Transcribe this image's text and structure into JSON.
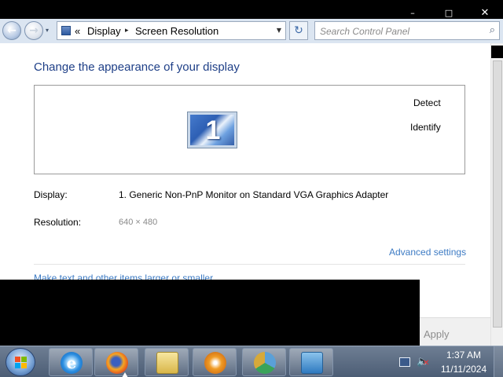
{
  "window": {
    "controls": {
      "minimize": "–",
      "maximize": "□",
      "close": "✕"
    }
  },
  "navbar": {
    "back_icon": "back-arrow-icon",
    "forward_icon": "forward-arrow-icon",
    "recent_pages": "▾",
    "breadcrumb_chevron": "«",
    "breadcrumb": [
      "Display",
      "Screen Resolution"
    ],
    "breadcrumb_sep": "▸",
    "dropdown": "▼",
    "refresh": "↻",
    "search_placeholder": "Search Control Panel",
    "search_icon": "⌕"
  },
  "main": {
    "heading": "Change the appearance of your display",
    "monitor_number": "1",
    "detect_label": "Detect",
    "identify_label": "Identify",
    "display_label": "Display:",
    "display_value": "1. Generic Non-PnP Monitor on Standard VGA Graphics Adapter",
    "resolution_label": "Resolution:",
    "resolution_value": "640 × 480",
    "advanced_link": "Advanced settings",
    "partial_link": "Make text and other items larger or smaller",
    "apply_button": "Apply"
  },
  "taskbar": {
    "pinned": [
      {
        "name": "internet-explorer",
        "glyph": "e"
      },
      {
        "name": "firefox",
        "glyph": ""
      },
      {
        "name": "windows-explorer",
        "glyph": ""
      },
      {
        "name": "media-player",
        "glyph": ""
      },
      {
        "name": "chrome",
        "glyph": ""
      },
      {
        "name": "control-panel",
        "glyph": ""
      }
    ],
    "clock_time": "1:37 AM",
    "clock_date": "11/11/2024"
  }
}
